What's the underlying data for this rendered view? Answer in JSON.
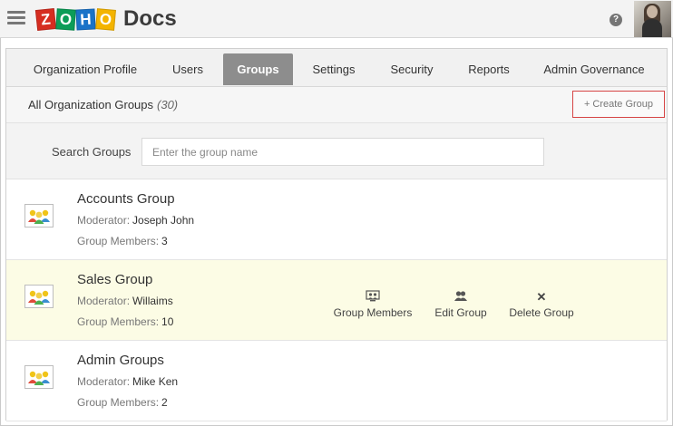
{
  "app": {
    "logo_letters": [
      {
        "char": "Z",
        "color": "#d62d20"
      },
      {
        "char": "O",
        "color": "#0c9d58"
      },
      {
        "char": "H",
        "color": "#1a73c8"
      },
      {
        "char": "O",
        "color": "#f4b400"
      }
    ],
    "product": "Docs",
    "help_glyph": "?"
  },
  "tabs": [
    {
      "label": "Organization Profile",
      "active": false
    },
    {
      "label": "Users",
      "active": false
    },
    {
      "label": "Groups",
      "active": true
    },
    {
      "label": "Settings",
      "active": false
    },
    {
      "label": "Security",
      "active": false
    },
    {
      "label": "Reports",
      "active": false
    },
    {
      "label": "Admin Governance",
      "active": false
    }
  ],
  "header": {
    "title": "All Organization Groups",
    "count": "(30)",
    "create_button": {
      "plus": "+",
      "label": "Create Group"
    }
  },
  "search": {
    "label": "Search Groups",
    "placeholder": "Enter the group name",
    "value": ""
  },
  "groups": [
    {
      "name": "Accounts Group",
      "moderator_label": "Moderator:",
      "moderator": "Joseph John",
      "members_label": "Group Members:",
      "members": "3"
    },
    {
      "name": "Sales Group",
      "moderator_label": "Moderator:",
      "moderator": "Willaims",
      "members_label": "Group Members:",
      "members": "10"
    },
    {
      "name": "Admin Groups",
      "moderator_label": "Moderator:",
      "moderator": "Mike Ken",
      "members_label": "Group Members:",
      "members": "2"
    }
  ],
  "row_actions": {
    "members": {
      "label": "Group Members",
      "icon": "group-members-icon"
    },
    "edit": {
      "label": "Edit Group",
      "icon": "users-icon"
    },
    "delete": {
      "label": "Delete Group",
      "icon": "close-icon",
      "glyph": "✕"
    }
  },
  "colors": {
    "active_tab": "#8d8d8d",
    "create_button_border": "#d64545",
    "highlight_row": "#fcfce5"
  }
}
